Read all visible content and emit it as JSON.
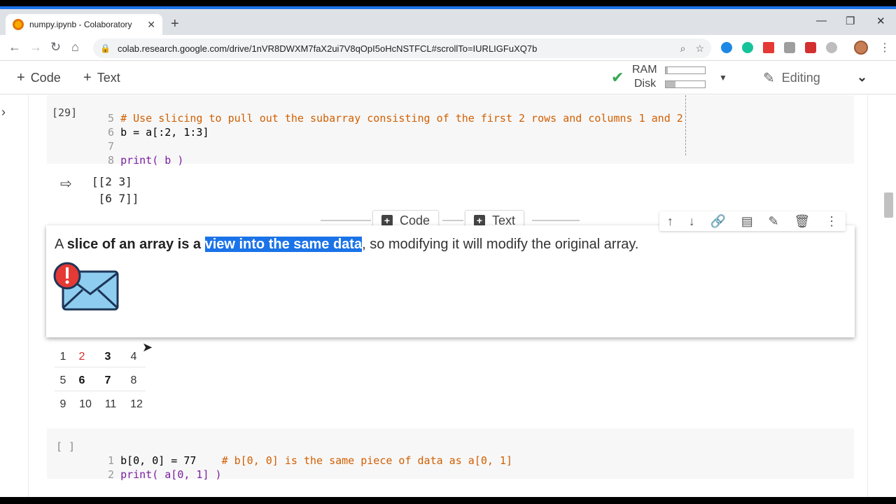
{
  "browser": {
    "tab_title": "numpy.ipynb - Colaboratory",
    "url": "colab.research.google.com/drive/1nVR8DWXM7faX2ui7V8qOpI5oHcNSTFCL#scrollTo=IURLIGFuXQ7b"
  },
  "toolbar": {
    "code_label": "Code",
    "text_label": "Text",
    "ram_label": "RAM",
    "disk_label": "Disk",
    "ram_fill": 0.05,
    "disk_fill": 0.25,
    "editing_label": "Editing"
  },
  "cell1": {
    "exec_label": "[29]",
    "lines": [
      {
        "num": "5",
        "code": "# Use slicing to pull out the subarray consisting of the first 2 rows and columns 1 and 2"
      },
      {
        "num": "6",
        "code": "b = a[:2, 1:3]"
      },
      {
        "num": "7",
        "code": ""
      },
      {
        "num": "8",
        "code": "print( b )"
      }
    ],
    "output": "[[2 3]\n [6 7]]"
  },
  "addbar": {
    "code_label": "Code",
    "text_label": "Text"
  },
  "textcell": {
    "part1": "A ",
    "part2": "slice of an array is a ",
    "highlight": "view into the same data",
    "part3": ", so modifying it will modify the original array."
  },
  "grid": {
    "rows": [
      [
        "1",
        "2",
        "3",
        "4"
      ],
      [
        "5",
        "6",
        "7",
        "8"
      ],
      [
        "9",
        "10",
        "11",
        "12"
      ]
    ]
  },
  "cell2": {
    "exec_label": "[ ]",
    "line1_num": "1",
    "line1_code": "b[0, 0] = 77",
    "line1_comment": "# b[0, 0] is the same piece of data as a[0, 1]",
    "line2_num": "2",
    "line2_code": "print( a[0, 1] )"
  },
  "colors": {
    "accent": "#1a73e8",
    "comment": "#d15f00",
    "keyword": "#7b1fa2",
    "number": "#098658",
    "check": "#34a853"
  }
}
